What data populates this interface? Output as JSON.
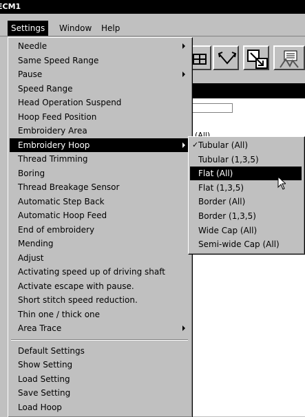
{
  "app": {
    "title": "ECM1"
  },
  "menubar": [
    {
      "label": "Settings",
      "active": true
    },
    {
      "label": "Window",
      "active": false
    },
    {
      "label": "Help",
      "active": false
    }
  ],
  "toolbar": {
    "icons": [
      "grid-icon",
      "merge-icon",
      "reposition-icon",
      "embroidery-preview-icon"
    ]
  },
  "mdi": {
    "partial_text": "(All)"
  },
  "settings_menu": {
    "items": [
      {
        "label": "Needle",
        "submenu": true
      },
      {
        "label": "Same Speed Range",
        "submenu": false
      },
      {
        "label": "Pause",
        "submenu": true
      },
      {
        "label": "Speed Range",
        "submenu": false
      },
      {
        "label": "Head Operation Suspend",
        "submenu": false
      },
      {
        "label": "Hoop Feed Position",
        "submenu": false
      },
      {
        "label": "Embroidery Area",
        "submenu": false
      },
      {
        "label": "Embroidery Hoop",
        "submenu": true,
        "highlighted": true
      },
      {
        "label": "Thread Trimming",
        "submenu": false
      },
      {
        "label": "Boring",
        "submenu": false
      },
      {
        "label": "Thread Breakage Sensor",
        "submenu": false
      },
      {
        "label": "Automatic Step Back",
        "submenu": false
      },
      {
        "label": "Automatic Hoop Feed",
        "submenu": false
      },
      {
        "label": "End of embroidery",
        "submenu": false
      },
      {
        "label": "Mending",
        "submenu": false
      },
      {
        "label": "Adjust",
        "submenu": false
      },
      {
        "label": "Activating speed up of driving shaft",
        "submenu": false
      },
      {
        "label": "Activate escape with pause.",
        "submenu": false
      },
      {
        "label": "Short stitch speed reduction.",
        "submenu": false
      },
      {
        "label": "Thin one / thick one",
        "submenu": false
      },
      {
        "label": "Area Trace",
        "submenu": true
      }
    ],
    "items_after_separator": [
      {
        "label": "Default Settings"
      },
      {
        "label": "Show Setting"
      },
      {
        "label": "Load Setting"
      },
      {
        "label": "Save Setting"
      },
      {
        "label": "Load Hoop"
      }
    ]
  },
  "hoop_submenu": {
    "items": [
      {
        "label": "Tubular (All)",
        "checked": true
      },
      {
        "label": "Tubular (1,3,5)",
        "checked": false
      },
      {
        "label": "Flat (All)",
        "checked": false,
        "highlighted": true
      },
      {
        "label": "Flat (1,3,5)",
        "checked": false
      },
      {
        "label": "Border (All)",
        "checked": false
      },
      {
        "label": "Border (1,3,5)",
        "checked": false
      },
      {
        "label": "Wide Cap (All)",
        "checked": false
      },
      {
        "label": "Semi-wide Cap (All)",
        "checked": false
      }
    ]
  }
}
